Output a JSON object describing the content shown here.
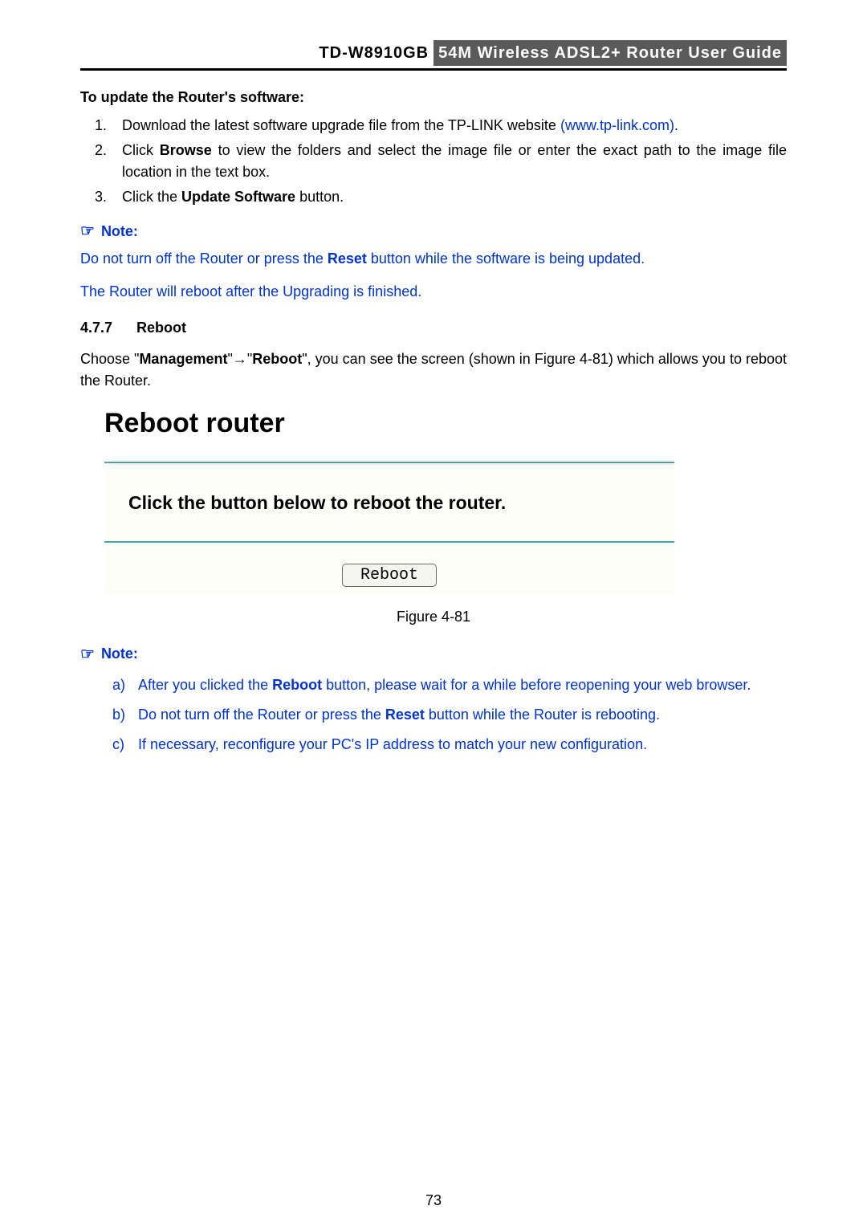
{
  "header": {
    "model": "TD-W8910GB",
    "title": "54M  Wireless  ADSL2+  Router  User  Guide"
  },
  "update": {
    "heading": "To update the Router's software:",
    "items": {
      "i1a": "Download the latest software upgrade file from the TP-LINK website ",
      "i1link": "(www.tp-link.com)",
      "i1b": ".",
      "i2a": "Click ",
      "i2b": "Browse",
      "i2c": " to view the folders and select the image file or enter the exact path to the image file location in the text box.",
      "i3a": "Click the ",
      "i3b": "Update Software",
      "i3c": " button."
    }
  },
  "note1": {
    "label": "Note:",
    "l1a": "Do not turn off the Router or press the ",
    "l1b": "Reset",
    "l1c": " button while the software is being updated.",
    "l2": "The Router will reboot after the Upgrading is finished."
  },
  "reboot": {
    "num": "4.7.7",
    "title": "Reboot",
    "p_a": "Choose \"",
    "p_b": "Management",
    "p_c": "\"",
    "arrow": "→",
    "p_d": "\"",
    "p_e": "Reboot",
    "p_f": "\", you can see the screen (shown in Figure 4-81) which allows you to reboot the Router."
  },
  "figure": {
    "title": "Reboot router",
    "prompt": "Click the button below to reboot the router.",
    "button": "Reboot",
    "caption": "Figure 4-81"
  },
  "note2": {
    "label": "Note:",
    "items": {
      "a": {
        "lbl": "a)",
        "t1": "After you clicked the ",
        "b": "Reboot",
        "t2": " button, please wait for a while before reopening your web browser."
      },
      "b": {
        "lbl": "b)",
        "t1": "Do not turn off the Router or press the ",
        "b": "Reset",
        "t2": " button while the Router is rebooting."
      },
      "c": {
        "lbl": "c)",
        "t1": "If necessary, reconfigure your PC's IP address to match your new configuration."
      }
    }
  },
  "pageno": "73"
}
